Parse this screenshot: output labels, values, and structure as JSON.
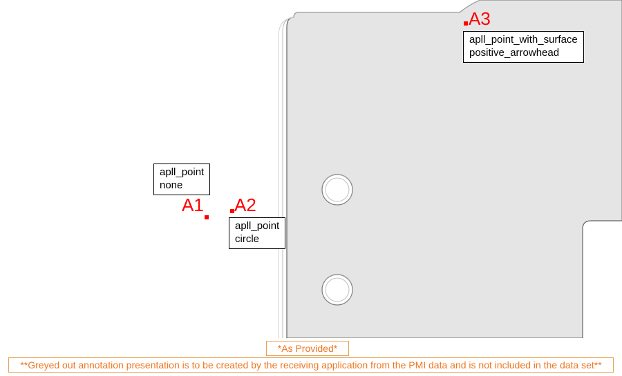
{
  "annotations": {
    "a1": {
      "label": "A1",
      "box_line1": "apll_point",
      "box_line2": "none"
    },
    "a2": {
      "label": "A2",
      "box_line1": "apll_point",
      "box_line2": "circle"
    },
    "a3": {
      "label": "A3",
      "box_line1": "apll_point_with_surface",
      "box_line2": "positive_arrowhead"
    }
  },
  "footer": {
    "caption": "*As Provided*",
    "note": "**Greyed out annotation presentation is to be created by the receiving application from the PMI data and is not included in the data set**"
  }
}
